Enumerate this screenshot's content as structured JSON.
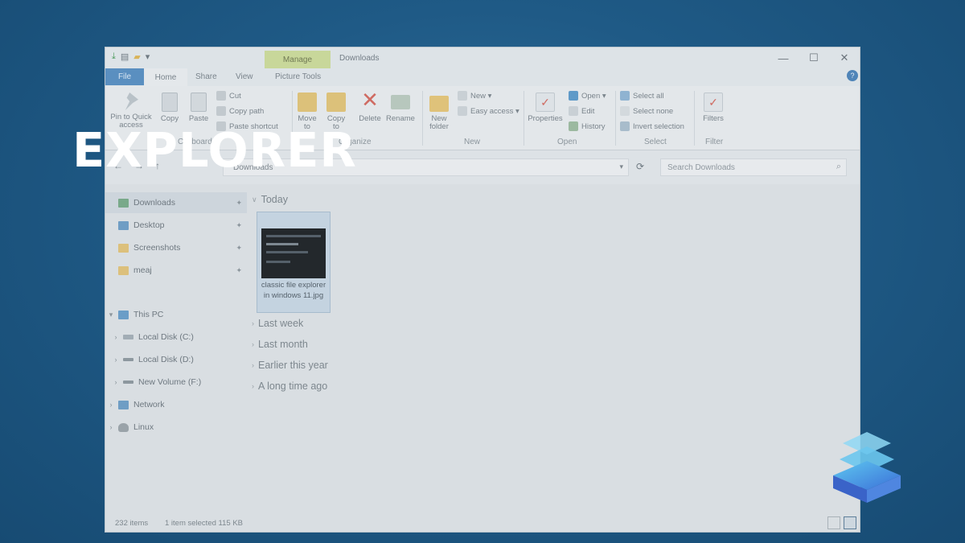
{
  "overlay": {
    "title": "EXPLORER"
  },
  "window": {
    "title": "Downloads",
    "manage_tab": "Manage",
    "controls": {
      "minimize": "—",
      "maximize": "☐",
      "close": "✕"
    },
    "help": "?"
  },
  "tabs": {
    "file": "File",
    "home": "Home",
    "share": "Share",
    "view": "View",
    "picture_tools": "Picture Tools"
  },
  "ribbon": {
    "clipboard": {
      "label": "Clipboard",
      "pin": "Pin to Quick access",
      "copy": "Copy",
      "paste": "Paste",
      "cut": "Cut",
      "copy_path": "Copy path",
      "paste_shortcut": "Paste shortcut"
    },
    "organize": {
      "label": "Organize",
      "move_to": "Move to",
      "copy_to": "Copy to",
      "delete": "Delete",
      "rename": "Rename"
    },
    "new": {
      "label": "New",
      "new_folder": "New folder",
      "new_item": "New ▾",
      "easy_access": "Easy access ▾"
    },
    "open": {
      "label": "Open",
      "properties": "Properties",
      "open": "Open ▾",
      "edit": "Edit",
      "history": "History"
    },
    "select": {
      "label": "Select",
      "select_all": "Select all",
      "select_none": "Select none",
      "invert": "Invert selection"
    },
    "filter": {
      "label": "Filter",
      "filters": "Filters"
    }
  },
  "address": {
    "path": "Downloads",
    "search_placeholder": "Search Downloads"
  },
  "sidebar": {
    "quick": [
      {
        "label": "Downloads",
        "pinned": true
      },
      {
        "label": "Desktop",
        "pinned": true
      },
      {
        "label": "Screenshots",
        "pinned": true
      },
      {
        "label": "meaj",
        "pinned": true
      }
    ],
    "tree": [
      {
        "label": "This PC"
      },
      {
        "label": "Local Disk (C:)"
      },
      {
        "label": "Local Disk (D:)"
      },
      {
        "label": "New Volume (F:)"
      },
      {
        "label": "Network"
      },
      {
        "label": "Linux"
      }
    ]
  },
  "content": {
    "groups": [
      "Today",
      "Last week",
      "Last month",
      "Earlier this year",
      "A long time ago"
    ],
    "file": {
      "name": "classic file explorer in windows 11.jpg"
    }
  },
  "status": {
    "items": "232 items",
    "selected": "1 item selected  115 KB"
  },
  "colors": {
    "accent": "#5a8fc0",
    "manage": "#c8d79a",
    "selection": "#c4d3e0"
  }
}
